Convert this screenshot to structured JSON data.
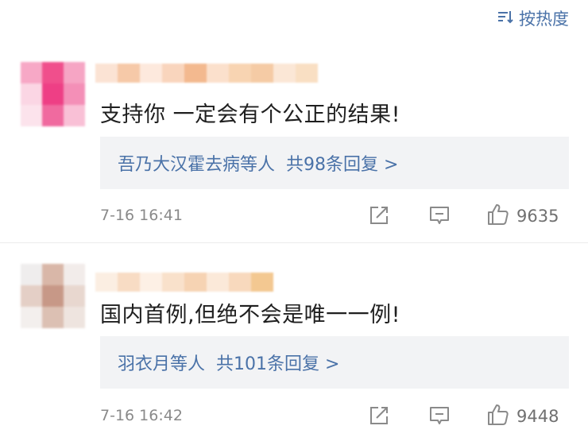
{
  "header": {
    "sort_label": "按热度"
  },
  "comments": [
    {
      "text": "支持你 一定会有个公正的结果!",
      "reply_names": "吾乃大汉霍去病等人",
      "reply_count": "共98条回复 >",
      "time": "7-16 16:41",
      "likes": "9635",
      "avatar_colors": [
        "#f7a8c6",
        "#f04f8c",
        "#f6a5c4",
        "#fbd6e4",
        "#ee3f85",
        "#f48fb7",
        "#fce3ec",
        "#f06a9f",
        "#f9c0d6"
      ],
      "username_colors": [
        "#fbe3d4",
        "#f6c9a8",
        "#fde9dd",
        "#f9d5bd",
        "#f3b98f",
        "#fbe0cc",
        "#f8d4b2",
        "#f5cba5",
        "#fbe7d6",
        "#f9dfc3"
      ]
    },
    {
      "text": "国内首例,但绝不会是唯一一例!",
      "reply_names": "羽衣月等人",
      "reply_count": "共101条回复 >",
      "time": "7-16 16:42",
      "likes": "9448",
      "avatar_colors": [
        "#efeded",
        "#d9b7a8",
        "#f2ecea",
        "#e4cfc6",
        "#c79887",
        "#e8d7cf",
        "#f3efed",
        "#dcc0b3",
        "#eee4df"
      ],
      "username_colors": [
        "#fbeee2",
        "#f8dcc4",
        "#fdf0e5",
        "#f9e1cb",
        "#f6d3b3",
        "#fbe9d9",
        "#f8d9bd",
        "#f3c891"
      ]
    }
  ]
}
